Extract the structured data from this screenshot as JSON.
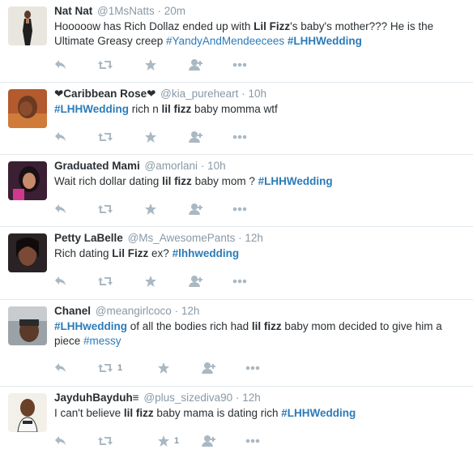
{
  "colors": {
    "link": "#2b7bb9",
    "meta": "#8899a6",
    "icon": "#aab8c2",
    "divider": "#e1e8ed"
  },
  "tweets": [
    {
      "fullname": "Nat Nat",
      "username": "@1MsNatts",
      "dot": "·",
      "time": "20m",
      "text_parts": [
        {
          "t": "Hooooow has Rich Dollaz ended up with ",
          "s": "n"
        },
        {
          "t": "Lil Fizz",
          "s": "b"
        },
        {
          "t": "'s baby's mother??? He is the Ultimate Greasy creep  ",
          "s": "n"
        },
        {
          "t": "#YandyAndMendeecees",
          "s": "h"
        },
        {
          "t": " ",
          "s": "n"
        },
        {
          "t": "#LHHWedding",
          "s": "hb"
        }
      ],
      "retweet_count": "",
      "favorite_count": ""
    },
    {
      "fullname": "❤Caribbean Rose❤",
      "username": "@kia_pureheart",
      "dot": "·",
      "time": "10h",
      "text_parts": [
        {
          "t": "#LHHWedding",
          "s": "hb"
        },
        {
          "t": " rich n ",
          "s": "n"
        },
        {
          "t": "lil fizz",
          "s": "b"
        },
        {
          "t": " baby momma wtf",
          "s": "n"
        }
      ],
      "retweet_count": "",
      "favorite_count": ""
    },
    {
      "fullname": "Graduated Mami",
      "username": "@amorlani",
      "dot": "·",
      "time": "10h",
      "text_parts": [
        {
          "t": "Wait rich dollar dating ",
          "s": "n"
        },
        {
          "t": "lil fizz",
          "s": "b"
        },
        {
          "t": " baby mom ? ",
          "s": "n"
        },
        {
          "t": "#LHHWedding",
          "s": "hb"
        }
      ],
      "retweet_count": "",
      "favorite_count": ""
    },
    {
      "fullname": "Petty LaBelle",
      "username": "@Ms_AwesomePants",
      "dot": "·",
      "time": "12h",
      "text_parts": [
        {
          "t": "Rich dating ",
          "s": "n"
        },
        {
          "t": "Lil Fizz",
          "s": "b"
        },
        {
          "t": " ex? ",
          "s": "n"
        },
        {
          "t": "#lhhwedding",
          "s": "hb"
        }
      ],
      "retweet_count": "",
      "favorite_count": ""
    },
    {
      "fullname": "Chanel",
      "username": "@meangirlcoco",
      "dot": "·",
      "time": "12h",
      "text_parts": [
        {
          "t": "#LHHwedding",
          "s": "hb"
        },
        {
          "t": " of all the bodies rich had ",
          "s": "n"
        },
        {
          "t": "lil fizz",
          "s": "b"
        },
        {
          "t": " baby mom decided to give him a piece ",
          "s": "n"
        },
        {
          "t": "#messy",
          "s": "h"
        }
      ],
      "retweet_count": "1",
      "favorite_count": ""
    },
    {
      "fullname": "JayduhBayduh≡",
      "username": "@plus_sizediva90",
      "dot": "·",
      "time": "12h",
      "text_parts": [
        {
          "t": "I can't believe ",
          "s": "n"
        },
        {
          "t": "lil fizz",
          "s": "b"
        },
        {
          "t": " baby mama is dating rich ",
          "s": "n"
        },
        {
          "t": "#LHHWedding",
          "s": "hb"
        }
      ],
      "retweet_count": "",
      "favorite_count": "1"
    }
  ]
}
